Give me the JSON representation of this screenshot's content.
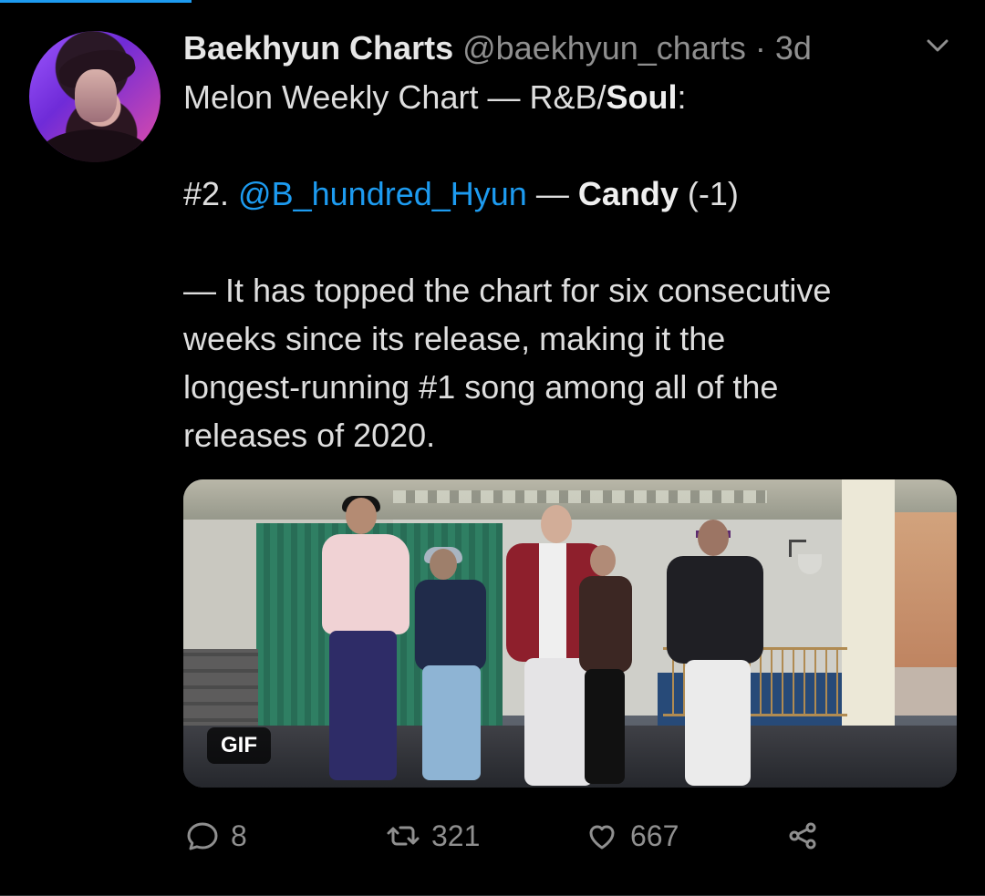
{
  "tweet": {
    "author_name": "Baekhyun Charts",
    "author_handle": "@baekhyun_charts",
    "separator": "·",
    "time_ago": "3d",
    "body_line1_prefix": "Melon Weekly Chart — R&B/",
    "body_line1_bold": "Soul",
    "body_line1_suffix": ":",
    "body_line2_rank": "#2. ",
    "body_line2_mention": "@B_hundred_Hyun",
    "body_line2_middle": " — ",
    "body_line2_song": "Candy",
    "body_line2_change": " (-1)",
    "body_line3": "— It has topped the chart for six consecutive",
    "body_line4": "weeks since its release, making it the",
    "body_line5": "longest-running #1 song among all of the",
    "body_line6": "releases of 2020.",
    "media_badge": "GIF",
    "reply_count": "8",
    "retweet_count": "321",
    "like_count": "667"
  },
  "icons": {
    "menu": "chevron-down-icon",
    "reply": "reply-icon",
    "retweet": "retweet-icon",
    "like": "heart-icon",
    "share": "share-icon"
  },
  "colors": {
    "background": "#000000",
    "text": "#d9d9d9",
    "muted": "#8f8f8f",
    "accent": "#1d9bf0"
  }
}
